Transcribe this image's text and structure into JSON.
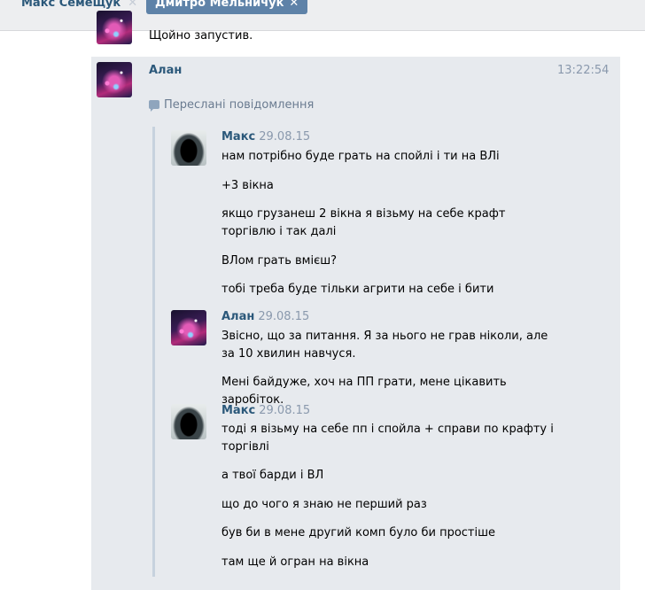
{
  "tabs": [
    {
      "label": "Макс Семещук",
      "close": "✕"
    },
    {
      "label": "Дмитро Мельничук",
      "close": "✕"
    }
  ],
  "previous_message": {
    "text": "Щойно запустив."
  },
  "message": {
    "author": "Алан",
    "time": "13:22:54",
    "forwarded_label": "Переслані повідомлення",
    "forwarded": [
      {
        "author": "Макс",
        "date": "29.08.15",
        "lines": [
          "нам потрібно буде грать на спойлі і ти на ВЛі",
          "+3 вікна",
          "якщо грузанеш 2 вікна я візьму на себе крафт торгівлю і так далі",
          "ВЛом грать вмієш?",
          "тобі треба буде тільки агрити на себе і бити"
        ]
      },
      {
        "author": "Алан",
        "date": "29.08.15",
        "lines": [
          "Звісно, що за питання. Я за нього не грав ніколи, але за 10 хвилин навчуся.",
          "Мені байдуже, хоч на ПП грати, мене цікавить заробіток."
        ]
      },
      {
        "author": "Макс",
        "date": "29.08.15",
        "lines": [
          "тоді я візьму на себе пп і спойла + справи по крафту і торгівлі",
          "а твої барди і ВЛ",
          "що до чого я знаю не перший раз",
          "був би в мене другий комп було би простіше",
          "там ще й огран на вікна"
        ]
      }
    ]
  }
}
